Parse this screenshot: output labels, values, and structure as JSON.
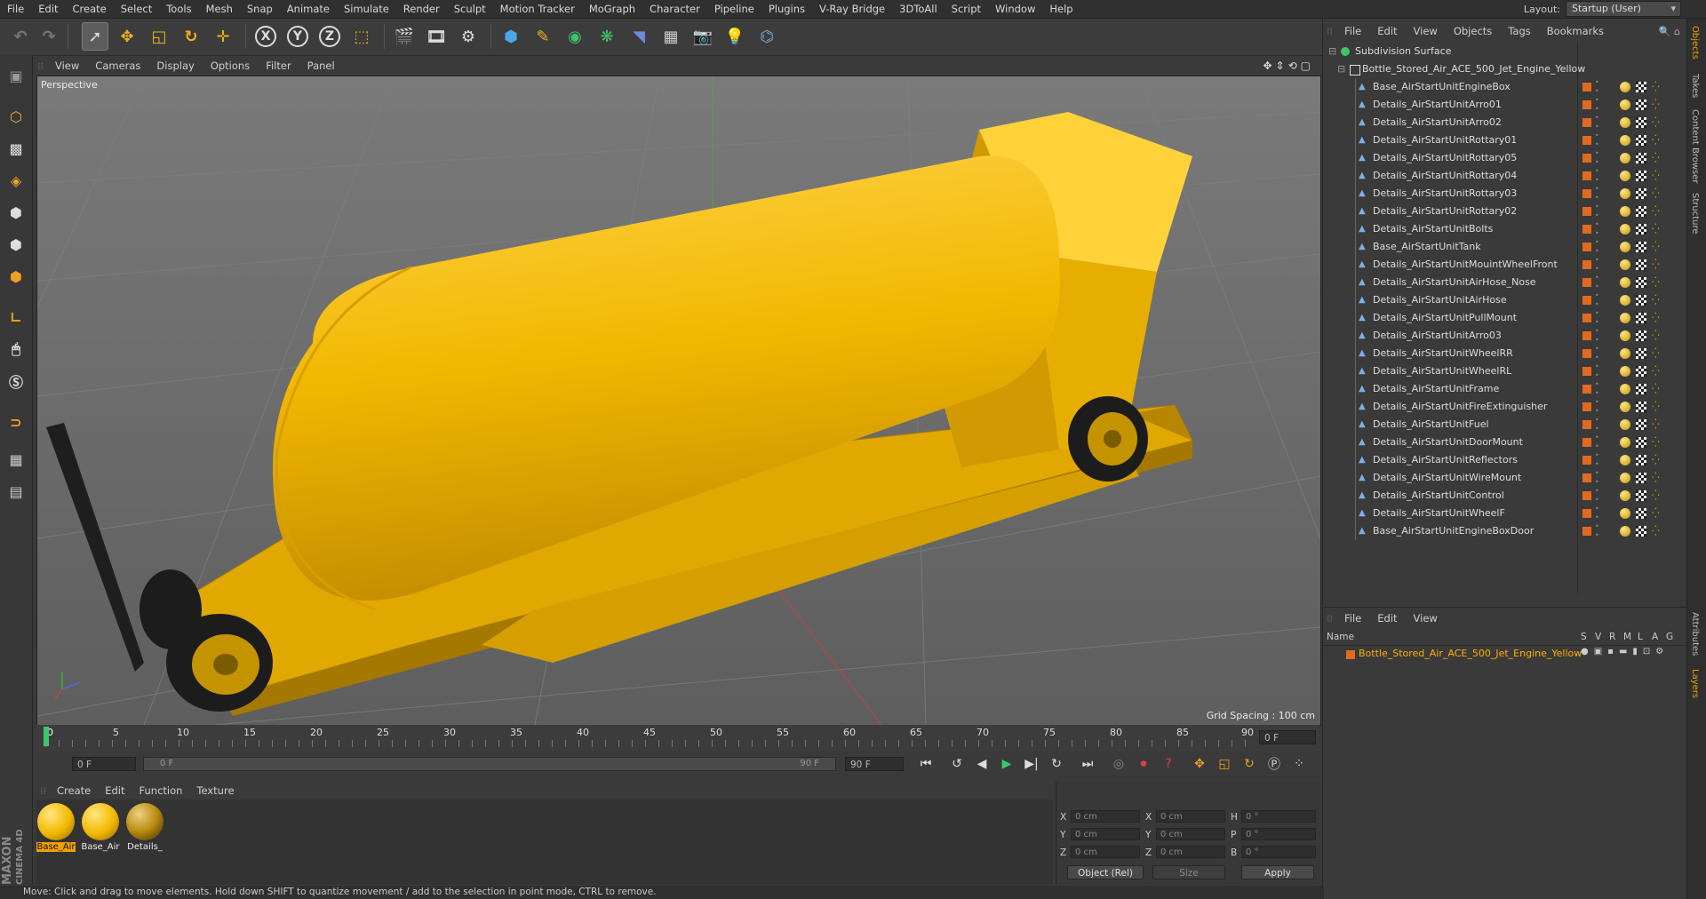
{
  "menu": [
    "File",
    "Edit",
    "Create",
    "Select",
    "Tools",
    "Mesh",
    "Snap",
    "Animate",
    "Simulate",
    "Render",
    "Sculpt",
    "Motion Tracker",
    "MoGraph",
    "Character",
    "Pipeline",
    "Plugins",
    "V-Ray Bridge",
    "3DToAll",
    "Script",
    "Window",
    "Help"
  ],
  "layout": {
    "label": "Layout:",
    "value": "Startup (User)"
  },
  "toolbar": {
    "axis_x": "X",
    "axis_y": "Y",
    "axis_z": "Z"
  },
  "viewport": {
    "menu": [
      "View",
      "Cameras",
      "Display",
      "Options",
      "Filter",
      "Panel"
    ],
    "label": "Perspective",
    "grid_spacing": "Grid Spacing : 100 cm"
  },
  "timeline": {
    "ticks": [
      "0",
      "5",
      "10",
      "15",
      "20",
      "25",
      "30",
      "35",
      "40",
      "45",
      "50",
      "55",
      "60",
      "65",
      "70",
      "75",
      "80",
      "85",
      "90"
    ],
    "current_frame": "0 F",
    "start_field": "0 F",
    "range_start": "0 F",
    "range_end": "90 F",
    "end_field": "90 F"
  },
  "material_manager": {
    "menu": [
      "Create",
      "Edit",
      "Function",
      "Texture"
    ],
    "materials": [
      {
        "name": "Base_Air",
        "selected": true
      },
      {
        "name": "Base_Air",
        "selected": false
      },
      {
        "name": "Details_",
        "selected": false
      }
    ]
  },
  "coordinates": {
    "rows": [
      {
        "a": "X",
        "av": "0 cm",
        "b": "X",
        "bv": "0 cm",
        "c": "H",
        "cv": "0 °"
      },
      {
        "a": "Y",
        "av": "0 cm",
        "b": "Y",
        "bv": "0 cm",
        "c": "P",
        "cv": "0 °"
      },
      {
        "a": "Z",
        "av": "0 cm",
        "b": "Z",
        "bv": "0 cm",
        "c": "B",
        "cv": "0 °"
      }
    ],
    "mode": "Object (Rel)",
    "size": "Size",
    "apply": "Apply"
  },
  "status": "Move: Click and drag to move elements. Hold down SHIFT to quantize movement / add to the selection in point mode, CTRL to remove.",
  "object_manager": {
    "menu": [
      "File",
      "Edit",
      "View",
      "Objects",
      "Tags",
      "Bookmarks"
    ],
    "root": "Subdivision Surface",
    "group": "Bottle_Stored_Air_ACE_500_Jet_Engine_Yellow",
    "items": [
      "Base_AirStartUnitEngineBox",
      "Details_AirStartUnitArro01",
      "Details_AirStartUnitArro02",
      "Details_AirStartUnitRottary01",
      "Details_AirStartUnitRottary05",
      "Details_AirStartUnitRottary04",
      "Details_AirStartUnitRottary03",
      "Details_AirStartUnitRottary02",
      "Details_AirStartUnitBolts",
      "Base_AirStartUnitTank",
      "Details_AirStartUnitMouintWheelFront",
      "Details_AirStartUnitAirHose_Nose",
      "Details_AirStartUnitAirHose",
      "Details_AirStartUnitPullMount",
      "Details_AirStartUnitArro03",
      "Details_AirStartUnitWheelRR",
      "Details_AirStartUnitWheelRL",
      "Details_AirStartUnitFrame",
      "Details_AirStartUnitFireExtinguisher",
      "Details_AirStartUnitFuel",
      "Details_AirStartUnitDoorMount",
      "Details_AirStartUnitReflectors",
      "Details_AirStartUnitWireMount",
      "Details_AirStartUnitControl",
      "Details_AirStartUnitWheelF",
      "Base_AirStartUnitEngineBoxDoor"
    ]
  },
  "layers": {
    "menu": [
      "File",
      "Edit",
      "View"
    ],
    "columns": {
      "name": "Name",
      "s": "S",
      "v": "V",
      "r": "R",
      "m": "M",
      "l": "L",
      "a": "A",
      "g": "G"
    },
    "row": "Bottle_Stored_Air_ACE_500_Jet_Engine_Yellow"
  },
  "side_tabs": [
    "Objects",
    "Takes",
    "Content Browser",
    "Structure",
    "Attributes",
    "Layers"
  ],
  "brand": {
    "maxon": "MAXON",
    "product": "CINEMA 4D"
  },
  "colors": {
    "accent": "#f0a000",
    "selected_text": "#ffb000",
    "model_yellow": "#f2b800"
  }
}
